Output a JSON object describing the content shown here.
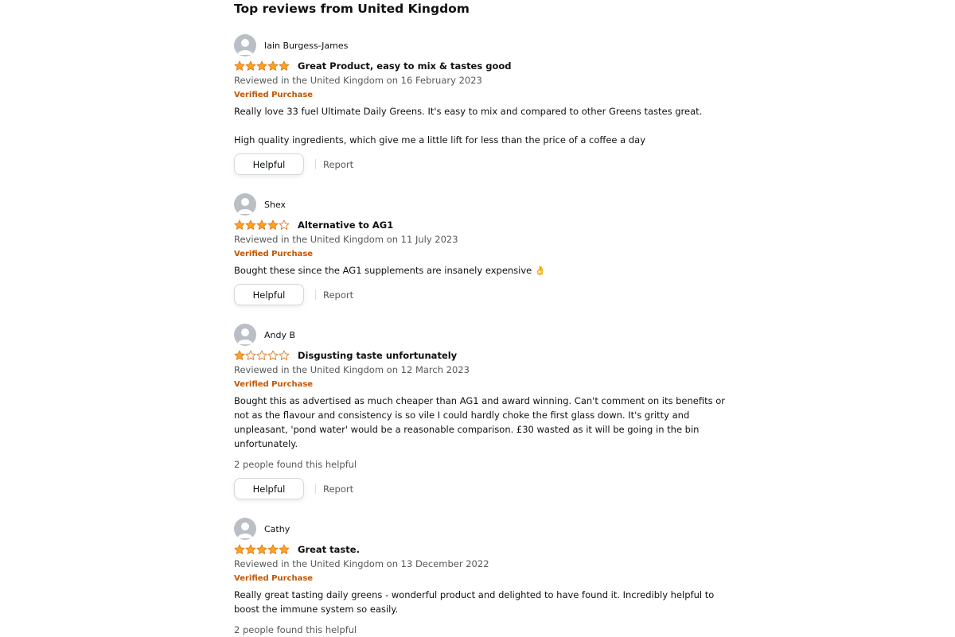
{
  "section": {
    "title": "Top reviews from United Kingdom"
  },
  "colors": {
    "star_fill": "#FFA41C",
    "star_stroke": "#DE7921",
    "verified": "#C45500",
    "muted": "#565959",
    "avatar_bg": "#b9bfc4"
  },
  "reviews": [
    {
      "author": "Iain Burgess-James",
      "rating": 5,
      "title": "Great Product, easy to mix & tastes good",
      "date": "Reviewed in the United Kingdom on 16 February 2023",
      "verified": "Verified Purchase",
      "body_p1": "Really love 33 fuel Ultimate Daily Greens. It's easy to mix and compared to other Greens tastes great.",
      "body_p2": "High quality ingredients, which give me a little lift for less than the price of a coffee a day",
      "helpful_label": "Helpful",
      "report_label": "Report"
    },
    {
      "author": "Shex",
      "rating": 4,
      "title": "Alternative to AG1",
      "date": "Reviewed in the United Kingdom on 11 July 2023",
      "verified": "Verified Purchase",
      "body_p1": "Bought these since the AG1 supplements are insanely expensive",
      "body_emoji": "👌",
      "helpful_label": "Helpful",
      "report_label": "Report"
    },
    {
      "author": "Andy B",
      "rating": 1,
      "title": "Disgusting taste unfortunately",
      "date": "Reviewed in the United Kingdom on 12 March 2023",
      "verified": "Verified Purchase",
      "body_p1": "Bought this as advertised as much cheaper than AG1 and award winning. Can't comment on its benefits or not as the flavour and consistency is so vile I could hardly choke the first glass down. It's gritty and unpleasant, 'pond water' would be a reasonable comparison. £30 wasted as it will be going in the bin unfortunately.",
      "helpful_count": "2 people found this helpful",
      "helpful_label": "Helpful",
      "report_label": "Report"
    },
    {
      "author": "Cathy",
      "rating": 5,
      "title": "Great taste.",
      "date": "Reviewed in the United Kingdom on 13 December 2022",
      "verified": "Verified Purchase",
      "body_p1": "Really great tasting daily greens - wonderful product and delighted to have found it. Incredibly helpful to boost the immune system so easily.",
      "helpful_count": "2 people found this helpful"
    }
  ]
}
